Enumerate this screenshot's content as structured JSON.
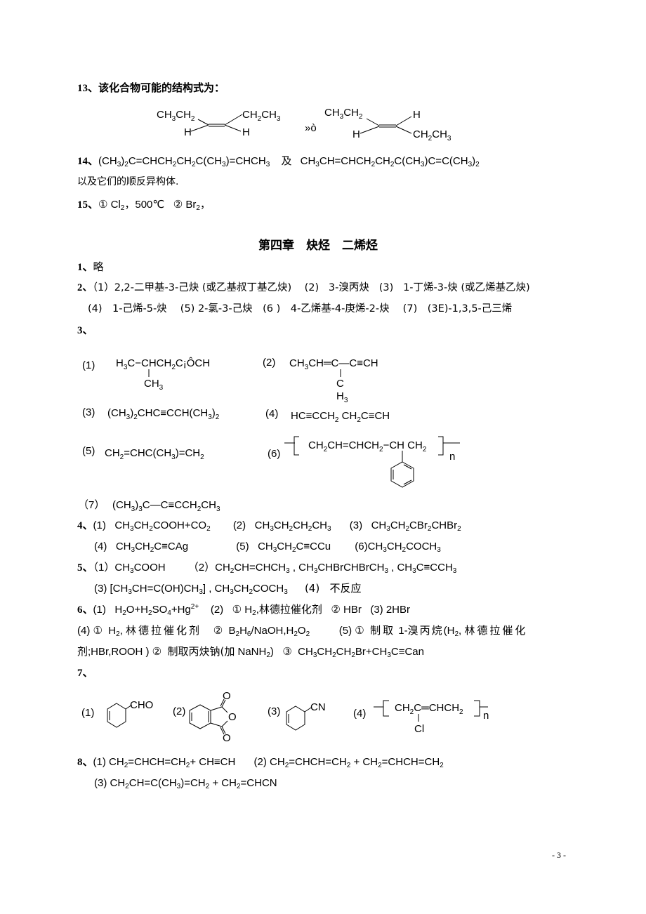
{
  "q13": {
    "label": "13、该化合物可能的结构式为：",
    "structure_a": {
      "top_left": "CH3CH2",
      "top_right": "CH2CH3",
      "bottom_left": "H",
      "bottom_right": "H"
    },
    "separator": "»ò",
    "structure_b": {
      "top_left": "CH3CH2",
      "top_right": "H",
      "bottom_left": "H",
      "bottom_right": "CH2CH3"
    }
  },
  "q14": {
    "label": "14、",
    "formula_a": "(CH3)2C=CHCH2CH2C(CH3)=CHCH3",
    "connector": "及",
    "formula_b": "CH3CH=CHCH2CH2C(CH3)C=C(CH3)2",
    "note": "以及它们的顺反异构体."
  },
  "q15": {
    "label": "15、",
    "text": "① Cl2，500℃  ② Br2，"
  },
  "chapter_title": "第四章　炔烃　二烯烃",
  "ch4": {
    "q1": {
      "label": "1、",
      "text": "略"
    },
    "q2": {
      "label": "2、",
      "line1": "（1）2,2-二甲基-3-己炔 (或乙基叔丁基乙炔)　(2)　3-溴丙炔　(3)　1-丁烯-3-炔 (或乙烯基乙炔)",
      "line2": "(4)　1-己烯-5-炔　 (5) 2-氯-3-己炔　(6 )　4-乙烯基-4-庚烯-2-炔　 (7)　(3E)-1,3,5-己三烯"
    },
    "q3": {
      "label": "3、",
      "items": [
        {
          "num": "(1)",
          "main": "H3C−CHCH2C¡ÔCH",
          "branch": "CH3"
        },
        {
          "num": "(2)",
          "main": "CH3CH═C—C≡CH",
          "branch_top": "C",
          "branch_bottom": "H3"
        },
        {
          "num": "(3)",
          "main": "(CH3)2CHC≡CCH(CH3)2"
        },
        {
          "num": "(4)",
          "main": "HC≡CCH2  CH2C≡CH"
        },
        {
          "num": "(5)",
          "main": "CH2=CHC(CH3)=CH2"
        },
        {
          "num": "(6)",
          "main": "CH2CH=CHCH2−CH CH2",
          "subscript": "n"
        },
        {
          "num": "（7）",
          "main": "(CH3)3C—C≡CCH2CH3"
        }
      ]
    },
    "q4": {
      "label": "4、",
      "items": [
        {
          "num": "(1)",
          "text": "CH3CH2COOH+CO2"
        },
        {
          "num": "(2)",
          "text": "CH3CH2CH2CH3"
        },
        {
          "num": "(3)",
          "text": "CH3CH2CBr2CHBr2"
        },
        {
          "num": "(4)",
          "text": "CH3CH2C≡CAg"
        },
        {
          "num": "(5)",
          "text": "CH3CH2C≡CCu"
        },
        {
          "num": "(6)",
          "text": "CH3CH2COCH3"
        }
      ]
    },
    "q5": {
      "label": "5、",
      "line1_a": "（1）CH3COOH",
      "line1_b": "（2）CH2CH=CHCH3 , CH3CHBrCHBrCH3 , CH3C≡CCH3",
      "line2_a": "(3) [CH3CH=C(OH)CH3] , CH3CH2COCH3",
      "line2_b": "(4)　不反应"
    },
    "q6": {
      "label": "6、",
      "line1": "(1)　H2O+H2SO4+Hg2+　 (2)　① H2,林德拉催化剂　② HBr　(3) 2HBr",
      "line2": "(4) ①  H2, 林 德 拉 催 化 剂　 ②  B2H6/NaOH,H2O2　　 (5) ①  制 取 1- 溴 丙 烷 (H2, 林 德 拉 催 化",
      "line3": "剂;HBr,ROOH ) ②  制取丙炔钠(加 NaNH2)　③  CH3CH2CH2Br+CH3C≡Can"
    },
    "q7": {
      "label": "7、",
      "items": [
        {
          "num": "(1)",
          "substituent": "CHO"
        },
        {
          "num": "(2)",
          "atoms": [
            "O",
            "O",
            "O"
          ]
        },
        {
          "num": "(3)",
          "substituent": "CN"
        },
        {
          "num": "(4)",
          "main": "CH2C═CHCH2",
          "branch": "Cl",
          "subscript": "n"
        }
      ]
    },
    "q8": {
      "label": "8、",
      "line1_a": "(1) CH2=CHCH=CH2+ CH≡CH",
      "line1_b": "(2) CH2=CHCH=CH2 + CH2=CHCH=CH2",
      "line2": "(3) CH2CH=C(CH3)=CH2 + CH2=CHCN"
    }
  },
  "page_number": "- 3 -"
}
